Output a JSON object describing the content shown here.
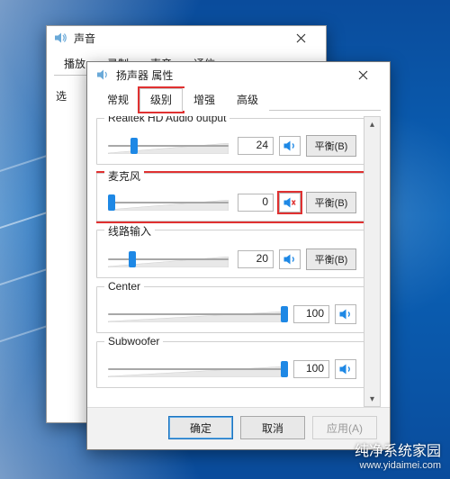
{
  "sound_window": {
    "title": "声音",
    "tabs": [
      "播放",
      "录制",
      "声音",
      "通信"
    ],
    "left_label_peek": "选"
  },
  "props_window": {
    "title": "扬声器 属性",
    "tabs": [
      {
        "label": "常规"
      },
      {
        "label": "级别",
        "active": true
      },
      {
        "label": "增强"
      },
      {
        "label": "高级"
      }
    ]
  },
  "groups": [
    {
      "id": "output",
      "title": "Realtek HD Audio output",
      "value": 24,
      "thumb_pct": 22,
      "muted": false,
      "balance": "平衡(B)"
    },
    {
      "id": "mic",
      "title": "麦克风",
      "value": 0,
      "thumb_pct": 3,
      "muted": true,
      "balance": "平衡(B)",
      "highlight": true
    },
    {
      "id": "linein",
      "title": "线路输入",
      "value": 20,
      "thumb_pct": 20,
      "muted": false,
      "balance": "平衡(B)"
    },
    {
      "id": "center",
      "title": "Center",
      "value": 100,
      "thumb_pct": 100,
      "muted": false
    },
    {
      "id": "sub",
      "title": "Subwoofer",
      "value": 100,
      "thumb_pct": 100,
      "muted": false
    }
  ],
  "buttons": {
    "ok": "确定",
    "cancel": "取消",
    "apply": "应用(A)"
  },
  "watermark": {
    "main": "纯净系统家园",
    "sub": "www.yidaimei.com"
  }
}
